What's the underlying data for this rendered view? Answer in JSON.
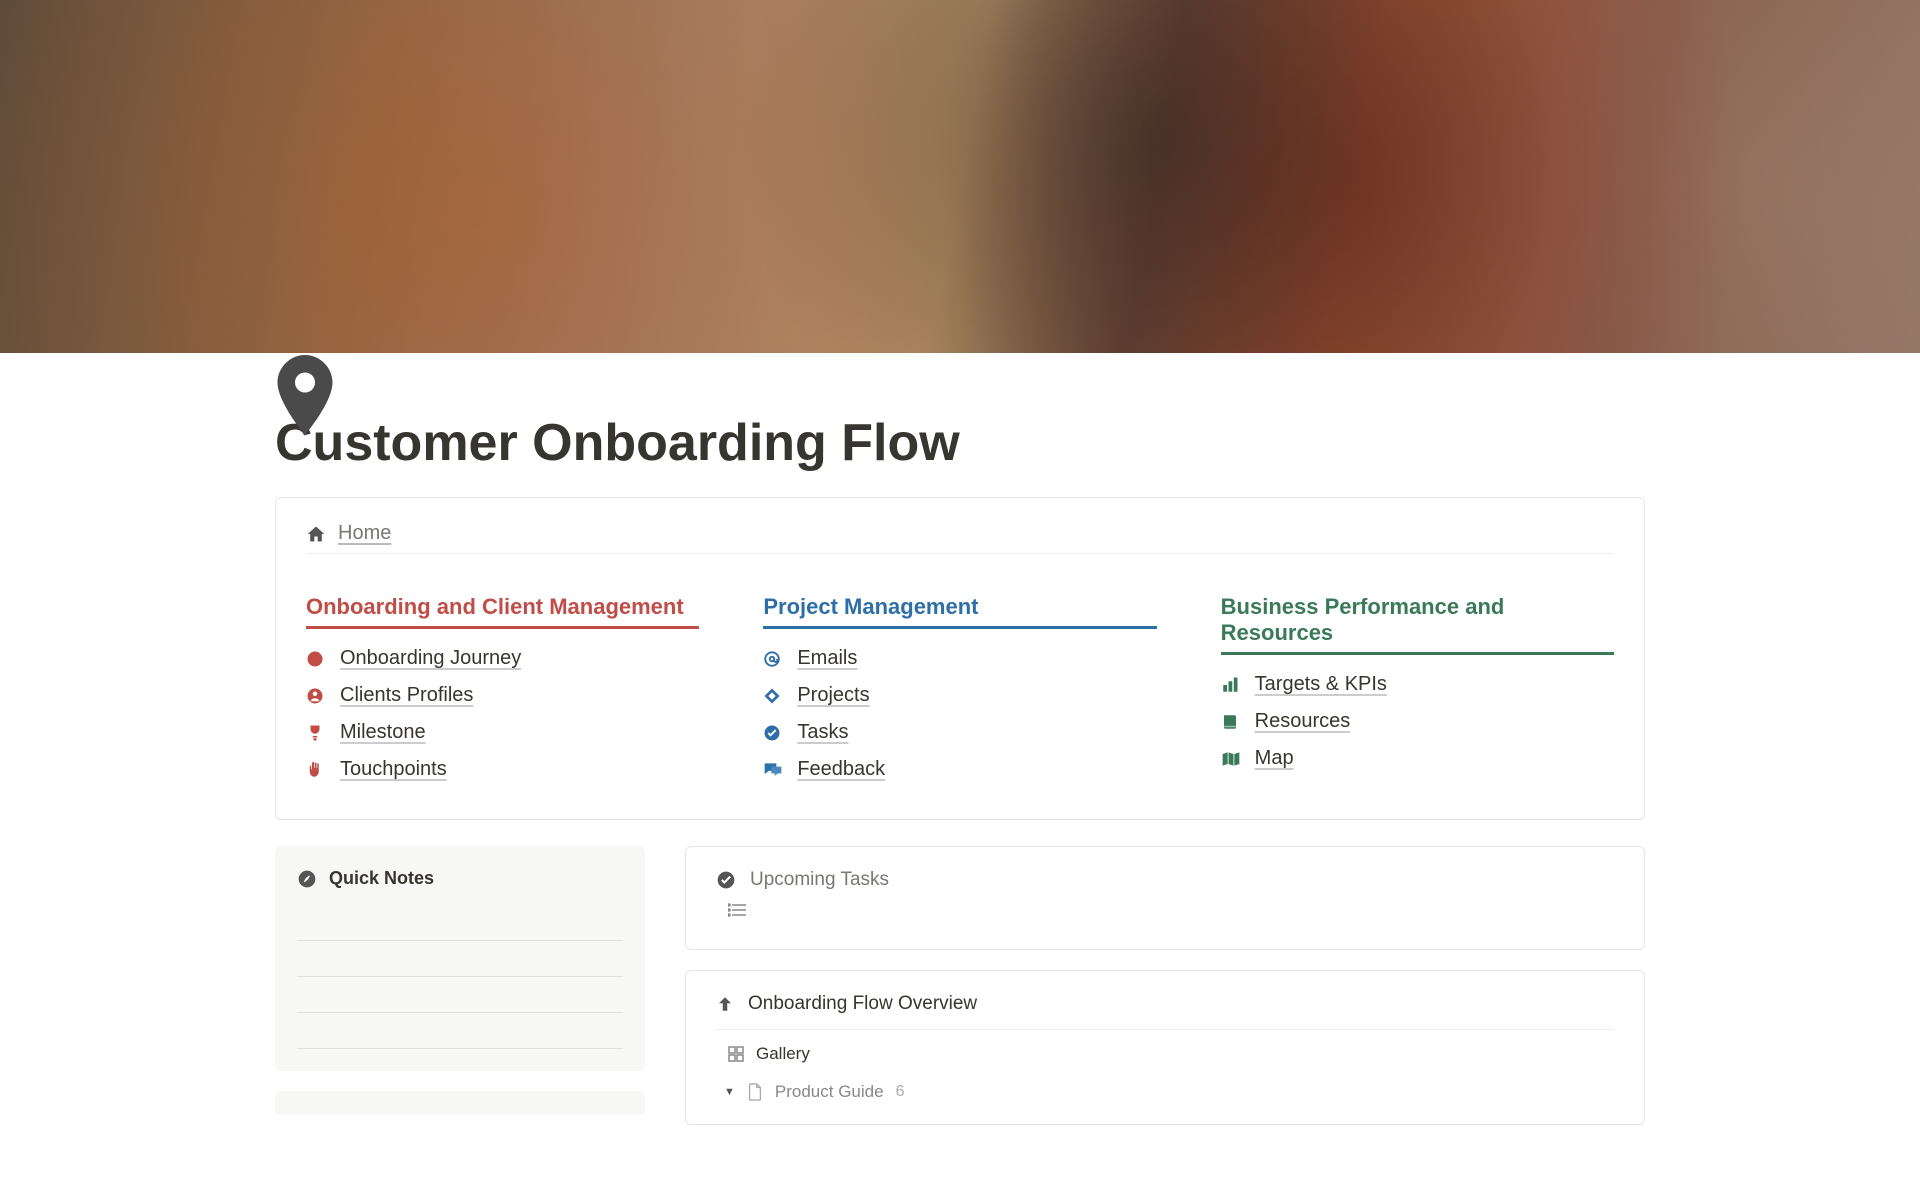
{
  "page": {
    "title": "Customer Onboarding Flow"
  },
  "breadcrumb": {
    "home": "Home"
  },
  "sections": {
    "onboarding": {
      "title": "Onboarding and Client Management",
      "items": [
        {
          "label": "Onboarding Journey"
        },
        {
          "label": "Clients Profiles"
        },
        {
          "label": "Milestone"
        },
        {
          "label": "Touchpoints"
        }
      ]
    },
    "project": {
      "title": "Project Management",
      "items": [
        {
          "label": "Emails"
        },
        {
          "label": "Projects"
        },
        {
          "label": "Tasks"
        },
        {
          "label": "Feedback"
        }
      ]
    },
    "business": {
      "title": "Business Performance and Resources",
      "items": [
        {
          "label": "Targets & KPIs"
        },
        {
          "label": "Resources"
        },
        {
          "label": "Map"
        }
      ]
    }
  },
  "sidebar": {
    "quicknotes_title": "Quick Notes"
  },
  "upcoming": {
    "title": "Upcoming Tasks"
  },
  "overview": {
    "title": "Onboarding Flow Overview",
    "view": "Gallery",
    "group": "Product Guide",
    "group_count": "6"
  }
}
